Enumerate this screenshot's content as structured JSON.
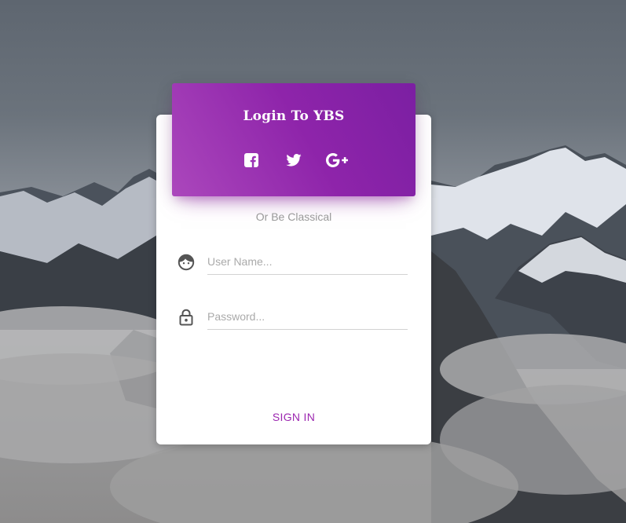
{
  "login": {
    "title": "Login To YBS",
    "social": [
      {
        "name": "facebook",
        "icon": "facebook-square-icon"
      },
      {
        "name": "twitter",
        "icon": "twitter-icon"
      },
      {
        "name": "google-plus",
        "icon": "google-plus-icon"
      }
    ],
    "divider_text": "Or Be Classical",
    "username": {
      "icon": "face-icon",
      "placeholder": "User Name...",
      "value": ""
    },
    "password": {
      "icon": "lock-outline-icon",
      "placeholder": "Password...",
      "value": ""
    },
    "submit_label": "SIGN IN"
  },
  "colors": {
    "accent": "#9c27b0",
    "header_gradient_start": "#ab47bc",
    "header_gradient_end": "#7b1fa2",
    "card_background": "#ffffff",
    "icon_color": "#555555"
  },
  "background": {
    "description_icon": "mountain-clouds-background"
  }
}
